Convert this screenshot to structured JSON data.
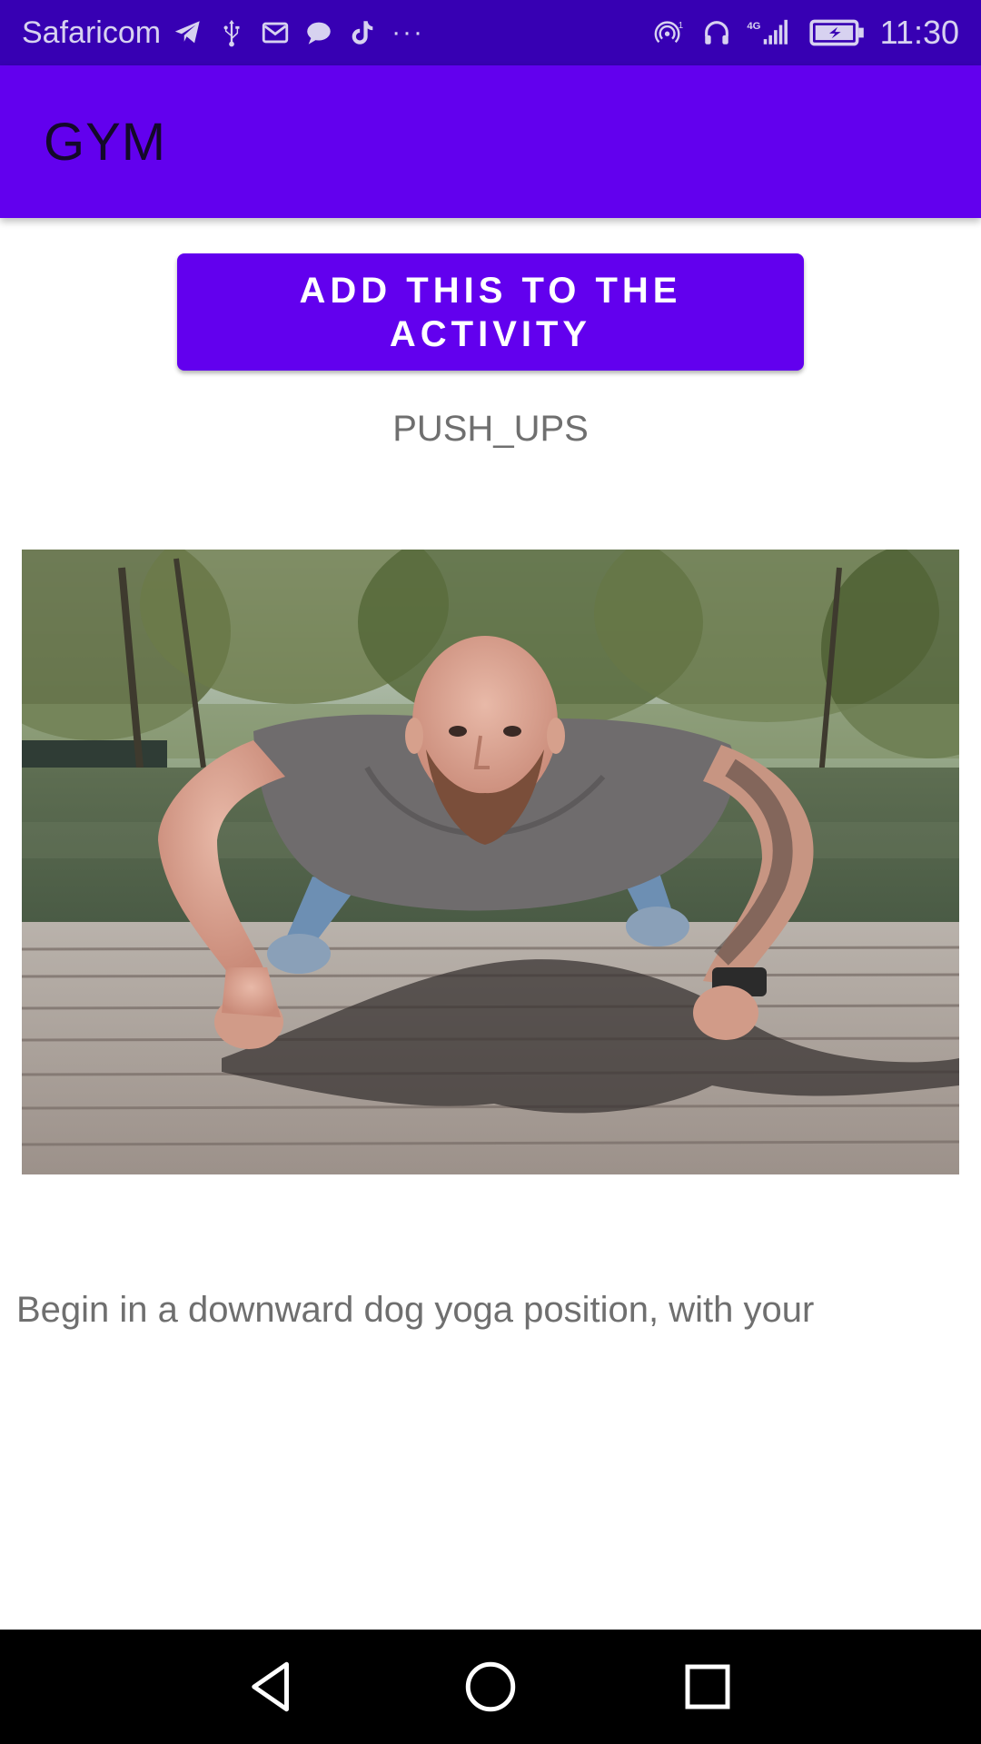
{
  "status_bar": {
    "carrier": "Safaricom",
    "more": "···",
    "time": "11:30",
    "network_label": "4G",
    "hotspot_badge": "1",
    "icons": [
      "telegram-icon",
      "usb-icon",
      "gmail-icon",
      "message-icon",
      "tiktok-icon",
      "hotspot-icon",
      "headphones-icon",
      "signal-icon",
      "battery-charging-icon"
    ]
  },
  "app_bar": {
    "title": "GYM"
  },
  "content": {
    "add_button_label": "ADD THIS TO THE ACTIVITY",
    "exercise_name": "PUSH_UPS",
    "image_subject": "man-doing-push-up-photo",
    "description": "Begin in a downward dog yoga position, with your"
  },
  "nav_bar": {
    "icons": [
      "back-icon",
      "home-icon",
      "recents-icon"
    ]
  },
  "colors": {
    "status_bar": "#3700b3",
    "app_bar": "#6200ee",
    "button": "#6200ee",
    "secondary_text": "#6f6f6f",
    "nav_bar": "#000000"
  }
}
